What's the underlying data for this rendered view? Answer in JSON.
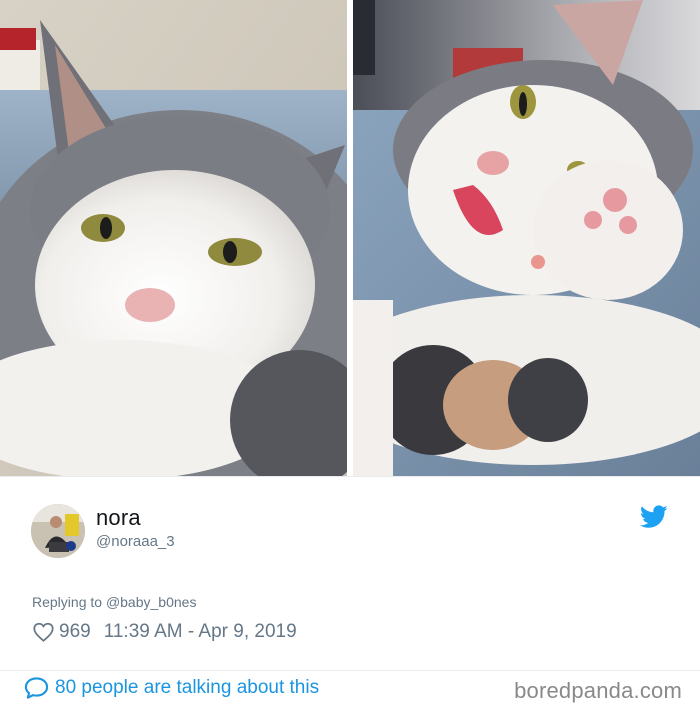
{
  "tweet": {
    "display_name": "nora",
    "handle": "@noraaa_3",
    "replying_prefix": "Replying to",
    "replying_to": "@baby_b0nes",
    "like_count": "969",
    "timestamp": "11:39 AM - Apr 9, 2019"
  },
  "footer": {
    "talking_label": "80 people are talking about this",
    "brand": "boredpanda.com"
  },
  "icons": {
    "twitter": "twitter-bird-icon",
    "heart": "heart-icon",
    "bubble": "speech-bubble-icon"
  },
  "colors": {
    "twitter_blue": "#1da1f2",
    "link_blue": "#1b95e0",
    "secondary_text": "#657786",
    "brand_gray": "#898989"
  }
}
